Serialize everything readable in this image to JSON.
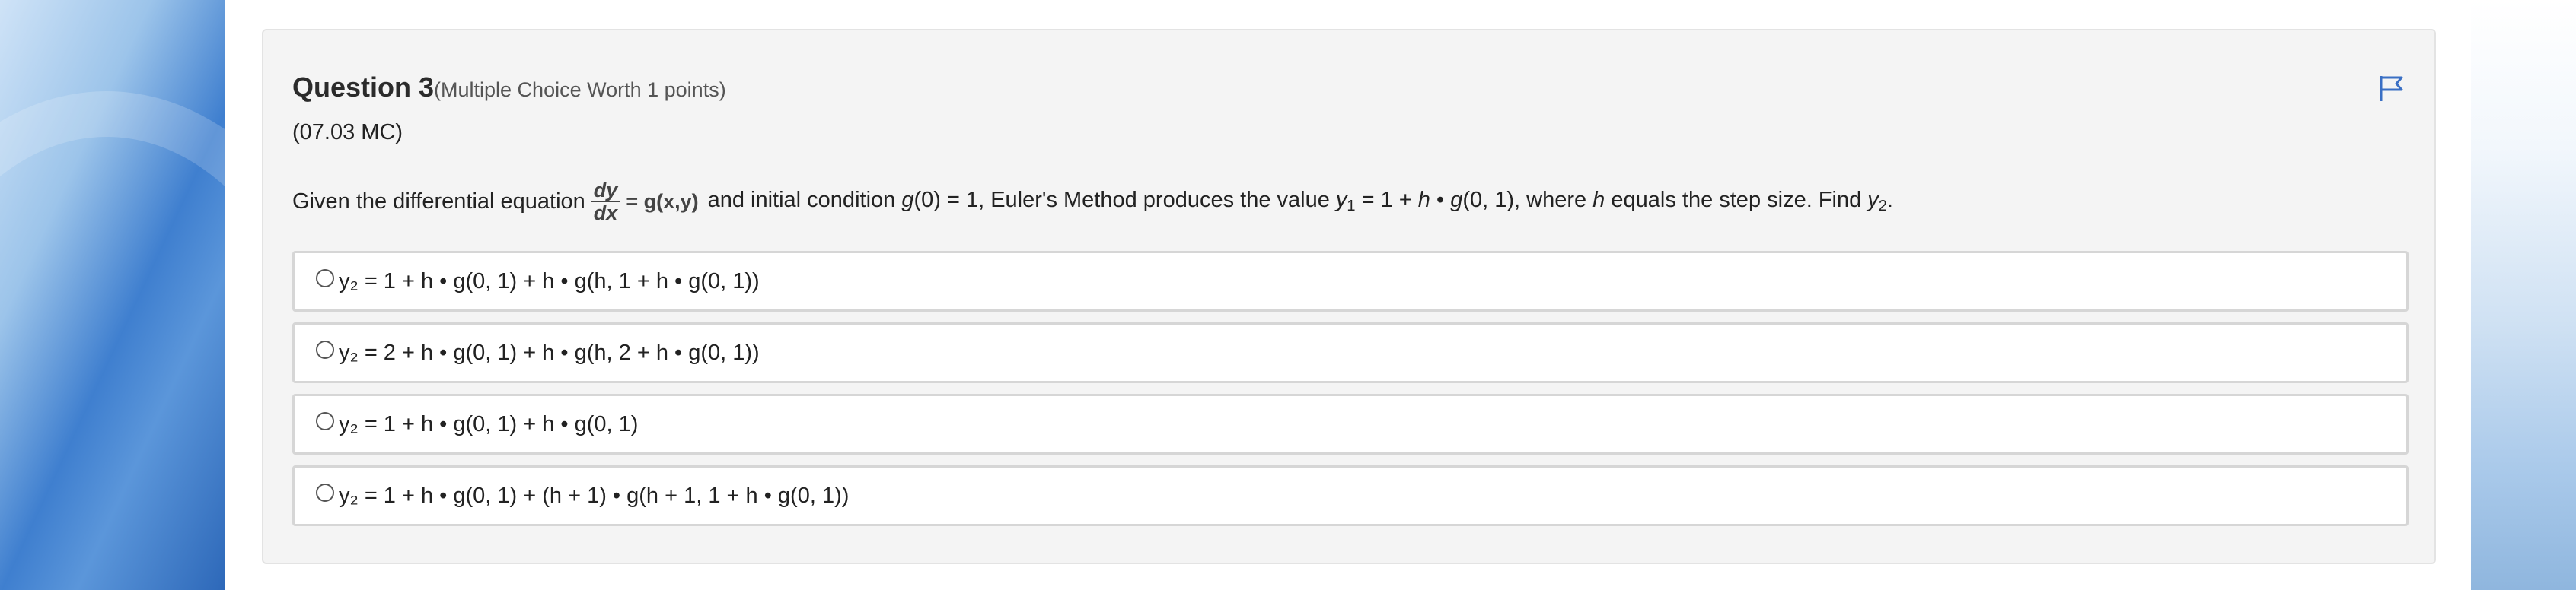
{
  "question": {
    "number_label": "Question 3",
    "worth_label": "(Multiple Choice Worth 1 points)",
    "code": "(07.03 MC)",
    "flag_icon": "flag-icon",
    "prompt": {
      "lead": "Given the differential equation",
      "numerator": "dy",
      "denominator": "dx",
      "rhs": "= g(x,y)",
      "p1": "and initial condition ",
      "g": "g",
      "p2": "(0) = 1, Euler's Method produces the value ",
      "y": "y",
      "sub1": "1",
      "p3": " = 1 + ",
      "h1": "h",
      "p4": " • ",
      "g2": "g",
      "p5": "(0, 1), where ",
      "h2": "h",
      "p6": " equals the step size. Find ",
      "y2": "y",
      "sub2": "2",
      "p7": "."
    }
  },
  "options": [
    {
      "text": "y₂ = 1 + h • g(0, 1) + h • g(h, 1 + h • g(0, 1))"
    },
    {
      "text": "y₂ = 2 + h • g(0, 1) + h • g(h, 2 + h • g(0, 1))"
    },
    {
      "text": "y₂ = 1 + h • g(0, 1) + h • g(0, 1)"
    },
    {
      "text": "y₂ = 1 + h • g(0, 1) + (h + 1) • g(h + 1, 1 + h • g(0, 1))"
    }
  ],
  "colors": {
    "flag": "#3a6fc4",
    "card_bg": "#f4f4f4",
    "option_border": "#d6d6d6"
  }
}
